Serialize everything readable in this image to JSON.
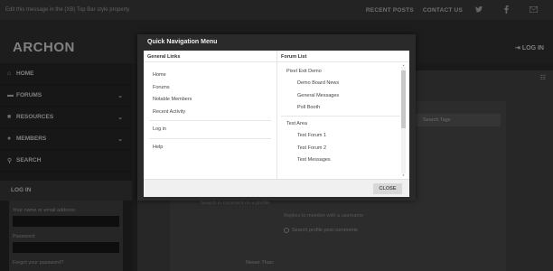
{
  "topbar": {
    "message": "Edit this message in the (XB) Top Bar style property",
    "links": [
      "RECENT POSTS",
      "CONTACT US"
    ],
    "social_icons": [
      "twitter-icon",
      "facebook-icon",
      "mail-icon"
    ]
  },
  "header": {
    "logo": "ARCHON",
    "login": "LOG IN"
  },
  "sidebar": {
    "items": [
      {
        "label": "HOME",
        "icon": "home-icon"
      },
      {
        "label": "FORUMS",
        "icon": "comments-icon",
        "expandable": true
      },
      {
        "label": "RESOURCES",
        "icon": "file-icon",
        "expandable": true
      },
      {
        "label": "MEMBERS",
        "icon": "users-icon",
        "expandable": true
      },
      {
        "label": "SEARCH",
        "icon": "search-icon"
      }
    ],
    "login_heading": "LOG IN",
    "login_name_label": "Your name or email address:",
    "login_password_label": "Password:",
    "login_forgot": "Forgot your password?"
  },
  "main": {
    "tag_placeholder": "Search Tags",
    "under1": "Search in comment on a profile",
    "under2": "Replies to member with a username",
    "profile_checkbox": "Search profile post comments",
    "newer_than": "Newer Than:"
  },
  "modal": {
    "title": "Quick Navigation Menu",
    "left_heading": "General Links",
    "links_group1": [
      "Home",
      "Forums",
      "Notable Members",
      "Recent Activity"
    ],
    "links_group2": [
      "Log in"
    ],
    "links_group3": [
      "Help"
    ],
    "right_heading": "Forum List",
    "forum_group1": {
      "category": "Pixel Exit Demo",
      "forums": [
        "Demo Board News",
        "General Messages",
        "Poll Booth"
      ]
    },
    "forum_group2": {
      "category": "Test Area",
      "forums": [
        "Test Forum 1",
        "Test Forum 2",
        "Test Messages"
      ]
    },
    "close_label": "CLOSE"
  }
}
